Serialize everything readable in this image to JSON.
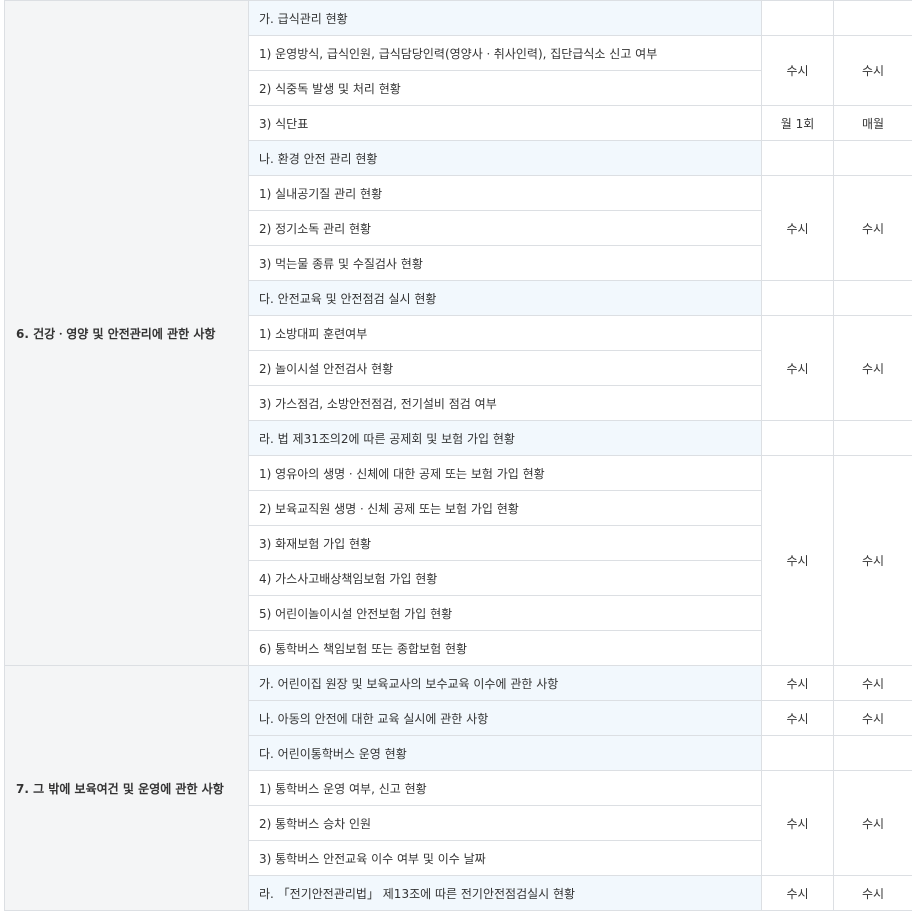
{
  "sections": [
    {
      "category": "6. 건강ㆍ영양 및 안전관리에 관한 사항",
      "groups": [
        {
          "title": "가. 급식관리 현황",
          "items": [
            "1) 운영방식, 급식인원, 급식담당인력(영양사ㆍ취사인력), 집단급식소 신고 여부",
            "2) 식중독 발생 및 처리 현황",
            "3) 식단표"
          ],
          "vals_a": "수시",
          "vals_b": "수시",
          "menu_a": "월 1회",
          "menu_b": "매월"
        },
        {
          "title": "나. 환경 안전 관리 현황",
          "items": [
            "1) 실내공기질 관리 현황",
            "2) 정기소독 관리 현황",
            "3) 먹는물 종류 및 수질검사 현황"
          ],
          "val_a": "수시",
          "val_b": "수시"
        },
        {
          "title": "다. 안전교육 및 안전점검 실시 현황",
          "items": [
            "1) 소방대피 훈련여부",
            "2) 놀이시설 안전검사 현황",
            "3) 가스점검, 소방안전점검, 전기설비 점검 여부"
          ],
          "val_a": "수시",
          "val_b": "수시"
        },
        {
          "title": "라. 법 제31조의2에 따른 공제회 및 보험 가입 현황",
          "items": [
            "1) 영유아의 생명ㆍ신체에 대한 공제 또는 보험 가입 현황",
            "2) 보육교직원 생명ㆍ신체 공제 또는 보험 가입 현황",
            "3) 화재보험 가입 현황",
            "4) 가스사고배상책임보험 가입 현황",
            "5) 어린이놀이시설 안전보험 가입 현황",
            "6) 통학버스 책임보험 또는 종합보험 현황"
          ],
          "val_a": "수시",
          "val_b": "수시"
        }
      ]
    },
    {
      "category": "7. 그 밖에 보육여건 및 운영에 관한 사항",
      "rows": [
        {
          "title": "가. 어린이집 원장 및 보육교사의 보수교육 이수에 관한 사항",
          "val_a": "수시",
          "val_b": "수시"
        },
        {
          "title": "나. 아동의 안전에 대한 교육 실시에 관한 사항",
          "val_a": "수시",
          "val_b": "수시"
        }
      ],
      "bus_group": {
        "title": "다. 어린이통학버스 운영 현황",
        "items": [
          "1) 통학버스 운영 여부, 신고 현황",
          "2) 통학버스 승차 인원",
          "3) 통학버스 안전교육 이수 여부 및 이수 날짜"
        ],
        "val_a": "수시",
        "val_b": "수시"
      },
      "last_row": {
        "title": "라. 「전기안전관리법」 제13조에 따른 전기안전점검실시 현황",
        "val_a": "수시",
        "val_b": "수시"
      }
    }
  ]
}
